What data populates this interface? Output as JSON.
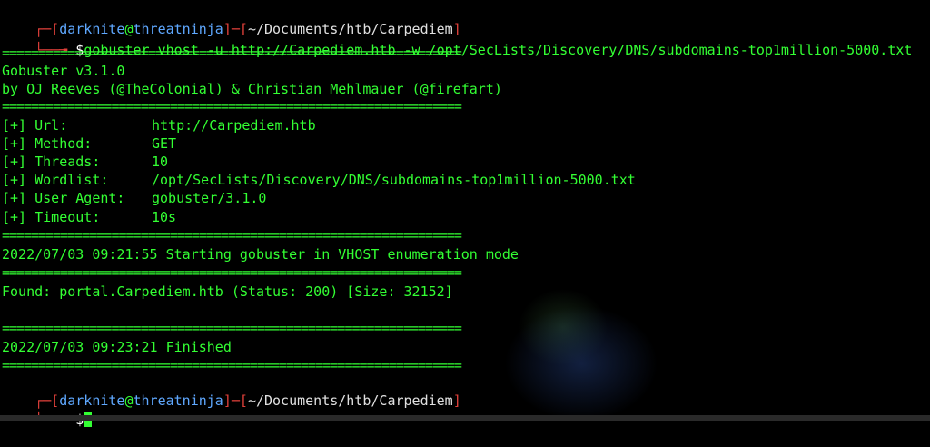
{
  "prompt1": {
    "open": "┌─[",
    "user": "darknite",
    "at": "@",
    "host": "threatninja",
    "mid": "]─[",
    "path": "~/Documents/htb/Carpediem",
    "close": "]",
    "line2": "└──╼ ",
    "dollar": "$",
    "command": "gobuster vhost -u http://Carpediem.htb -w /opt/SecLists/Discovery/DNS/subdomains-top1million-5000.txt"
  },
  "separator": "===============================================================",
  "banner": {
    "title": "Gobuster v3.1.0",
    "authors": "by OJ Reeves (@TheColonial) & Christian Mehlmauer (@firefart)"
  },
  "config": [
    {
      "key": "[+] Url:",
      "value": "http://Carpediem.htb"
    },
    {
      "key": "[+] Method:",
      "value": "GET"
    },
    {
      "key": "[+] Threads:",
      "value": "10"
    },
    {
      "key": "[+] Wordlist:",
      "value": "/opt/SecLists/Discovery/DNS/subdomains-top1million-5000.txt"
    },
    {
      "key": "[+] User Agent:",
      "value": "gobuster/3.1.0"
    },
    {
      "key": "[+] Timeout:",
      "value": "10s"
    }
  ],
  "start_line": "2022/07/03 09:21:55 Starting gobuster in VHOST enumeration mode",
  "found_line": "Found: portal.Carpediem.htb (Status: 200) [Size: 32152]",
  "finish_line": "2022/07/03 09:23:21 Finished",
  "prompt2": {
    "open": "┌─[",
    "user": "darknite",
    "at": "@",
    "host": "threatninja",
    "mid": "]─[",
    "path": "~/Documents/htb/Carpediem",
    "close": "]",
    "line2": "└──╼ ",
    "dollar": "$"
  }
}
